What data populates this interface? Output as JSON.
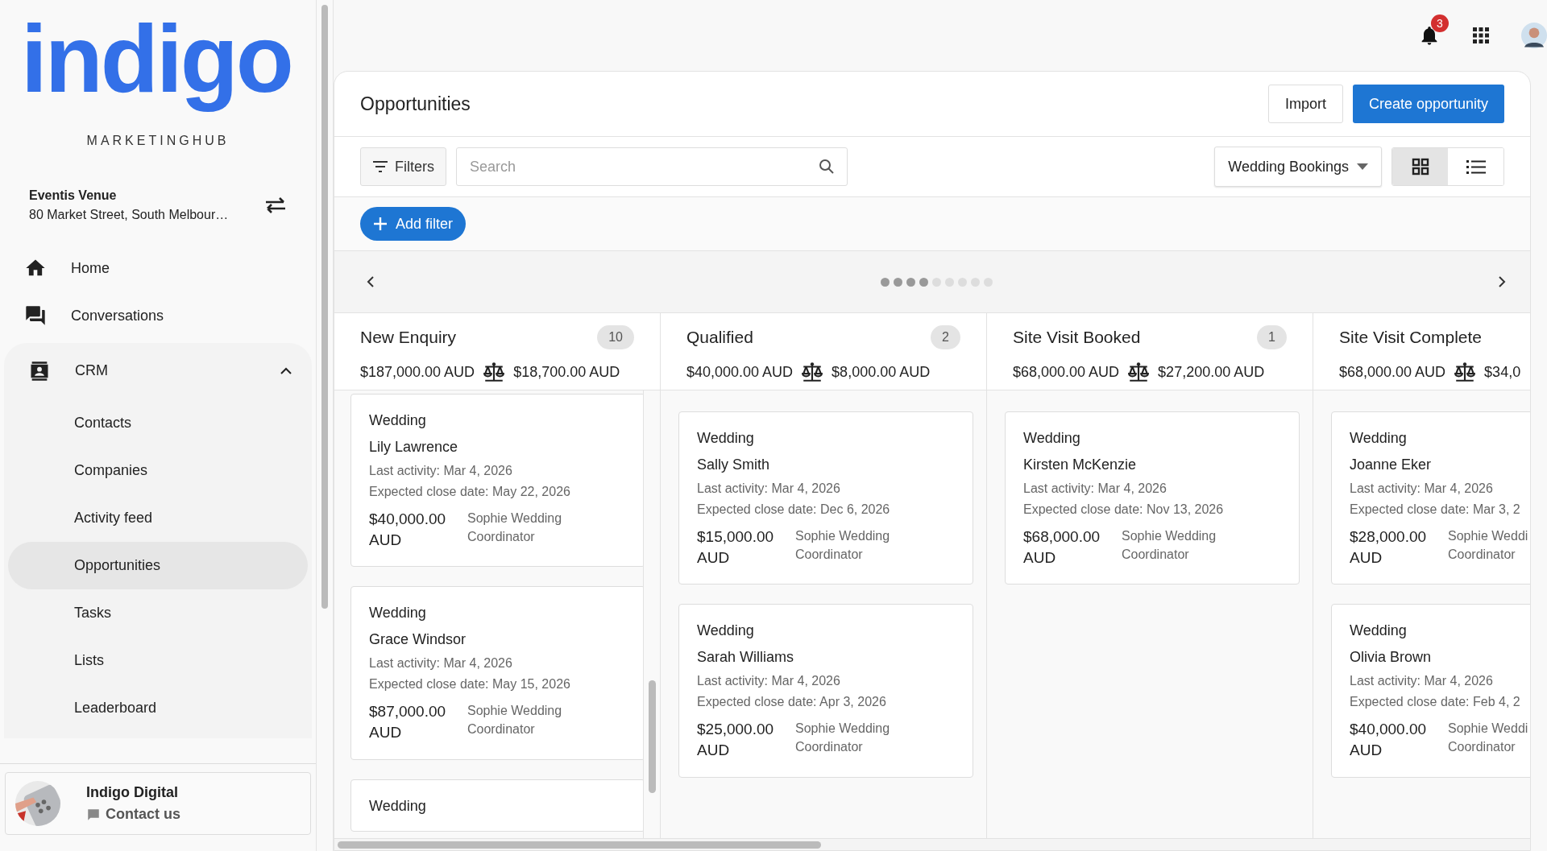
{
  "brand": {
    "logo": "indigo",
    "tagline": "MARKETINGHUB"
  },
  "account": {
    "name": "Eventis Venue",
    "address": "80 Market Street, South Melbour…"
  },
  "nav": [
    {
      "label": "Home",
      "selected": false
    },
    {
      "label": "Conversations",
      "selected": false
    },
    {
      "label": "CRM",
      "selected": false,
      "expanded": true,
      "children": [
        {
          "label": "Contacts",
          "selected": false
        },
        {
          "label": "Companies",
          "selected": false
        },
        {
          "label": "Activity feed",
          "selected": false
        },
        {
          "label": "Opportunities",
          "selected": true
        },
        {
          "label": "Tasks",
          "selected": false
        },
        {
          "label": "Lists",
          "selected": false
        },
        {
          "label": "Leaderboard",
          "selected": false
        }
      ]
    }
  ],
  "footer": {
    "org": "Indigo Digital",
    "link": "Contact us"
  },
  "topbar": {
    "notifications": "3"
  },
  "page": {
    "title": "Opportunities",
    "buttons": [
      {
        "label": "Import",
        "kind": "secondary"
      },
      {
        "label": "Create opportunity",
        "kind": "primary"
      }
    ]
  },
  "toolbar": {
    "filters": "Filters",
    "search": {
      "placeholder": "Search"
    },
    "pipeline": "Wedding Bookings",
    "views": [
      {
        "kind": "grid",
        "selected": true
      },
      {
        "kind": "list",
        "selected": false
      }
    ]
  },
  "add_filter": "Add filter",
  "pager": [
    {
      "selected": true
    },
    {
      "selected": true
    },
    {
      "selected": true
    },
    {
      "selected": true
    },
    {
      "selected": false
    },
    {
      "selected": false
    },
    {
      "selected": false
    },
    {
      "selected": false
    },
    {
      "selected": false
    }
  ],
  "columns": [
    {
      "title": "New Enquiry",
      "count": "10",
      "total": "$187,000.00 AUD",
      "weighted": "$18,700.00 AUD",
      "cards": [
        {
          "type": "Wedding",
          "name": "Lily Lawrence",
          "last_activity": "Last activity: Mar 4, 2026",
          "close": "Expected close date: May 22, 2026",
          "amount": "$40,000.00 AUD",
          "owner": "Sophie Wedding Coordinator"
        },
        {
          "type": "Wedding",
          "name": "Grace Windsor",
          "last_activity": "Last activity: Mar 4, 2026",
          "close": "Expected close date: May 15, 2026",
          "amount": "$87,000.00 AUD",
          "owner": "Sophie Wedding Coordinator"
        },
        {
          "type": "Wedding"
        }
      ]
    },
    {
      "title": "Qualified",
      "count": "2",
      "total": "$40,000.00 AUD",
      "weighted": "$8,000.00 AUD",
      "cards": [
        {
          "type": "Wedding",
          "name": "Sally Smith",
          "last_activity": "Last activity: Mar 4, 2026",
          "close": "Expected close date: Dec 6, 2026",
          "amount": "$15,000.00 AUD",
          "owner": "Sophie Wedding Coordinator"
        },
        {
          "type": "Wedding",
          "name": "Sarah Williams",
          "last_activity": "Last activity: Mar 4, 2026",
          "close": "Expected close date: Apr 3, 2026",
          "amount": "$25,000.00 AUD",
          "owner": "Sophie Wedding Coordinator"
        }
      ]
    },
    {
      "title": "Site Visit Booked",
      "count": "1",
      "total": "$68,000.00 AUD",
      "weighted": "$27,200.00 AUD",
      "cards": [
        {
          "type": "Wedding",
          "name": "Kirsten McKenzie",
          "last_activity": "Last activity: Mar 4, 2026",
          "close": "Expected close date: Nov 13, 2026",
          "amount": "$68,000.00 AUD",
          "owner": "Sophie Wedding Coordinator"
        }
      ]
    },
    {
      "title": "Site Visit Complete",
      "total": "$68,000.00 AUD",
      "weighted": "$34,0",
      "cards": [
        {
          "type": "Wedding",
          "name": "Joanne Eker",
          "last_activity": "Last activity: Mar 4, 2026",
          "close": "Expected close date: Mar 3, 2",
          "amount": "$28,000.00 AUD",
          "owner": "Sophie Weddi Coordinator"
        },
        {
          "type": "Wedding",
          "name": "Olivia Brown",
          "last_activity": "Last activity: Mar 4, 2026",
          "close": "Expected close date: Feb 4, 2",
          "amount": "$40,000.00 AUD",
          "owner": "Sophie Weddi Coordinator"
        }
      ]
    }
  ]
}
